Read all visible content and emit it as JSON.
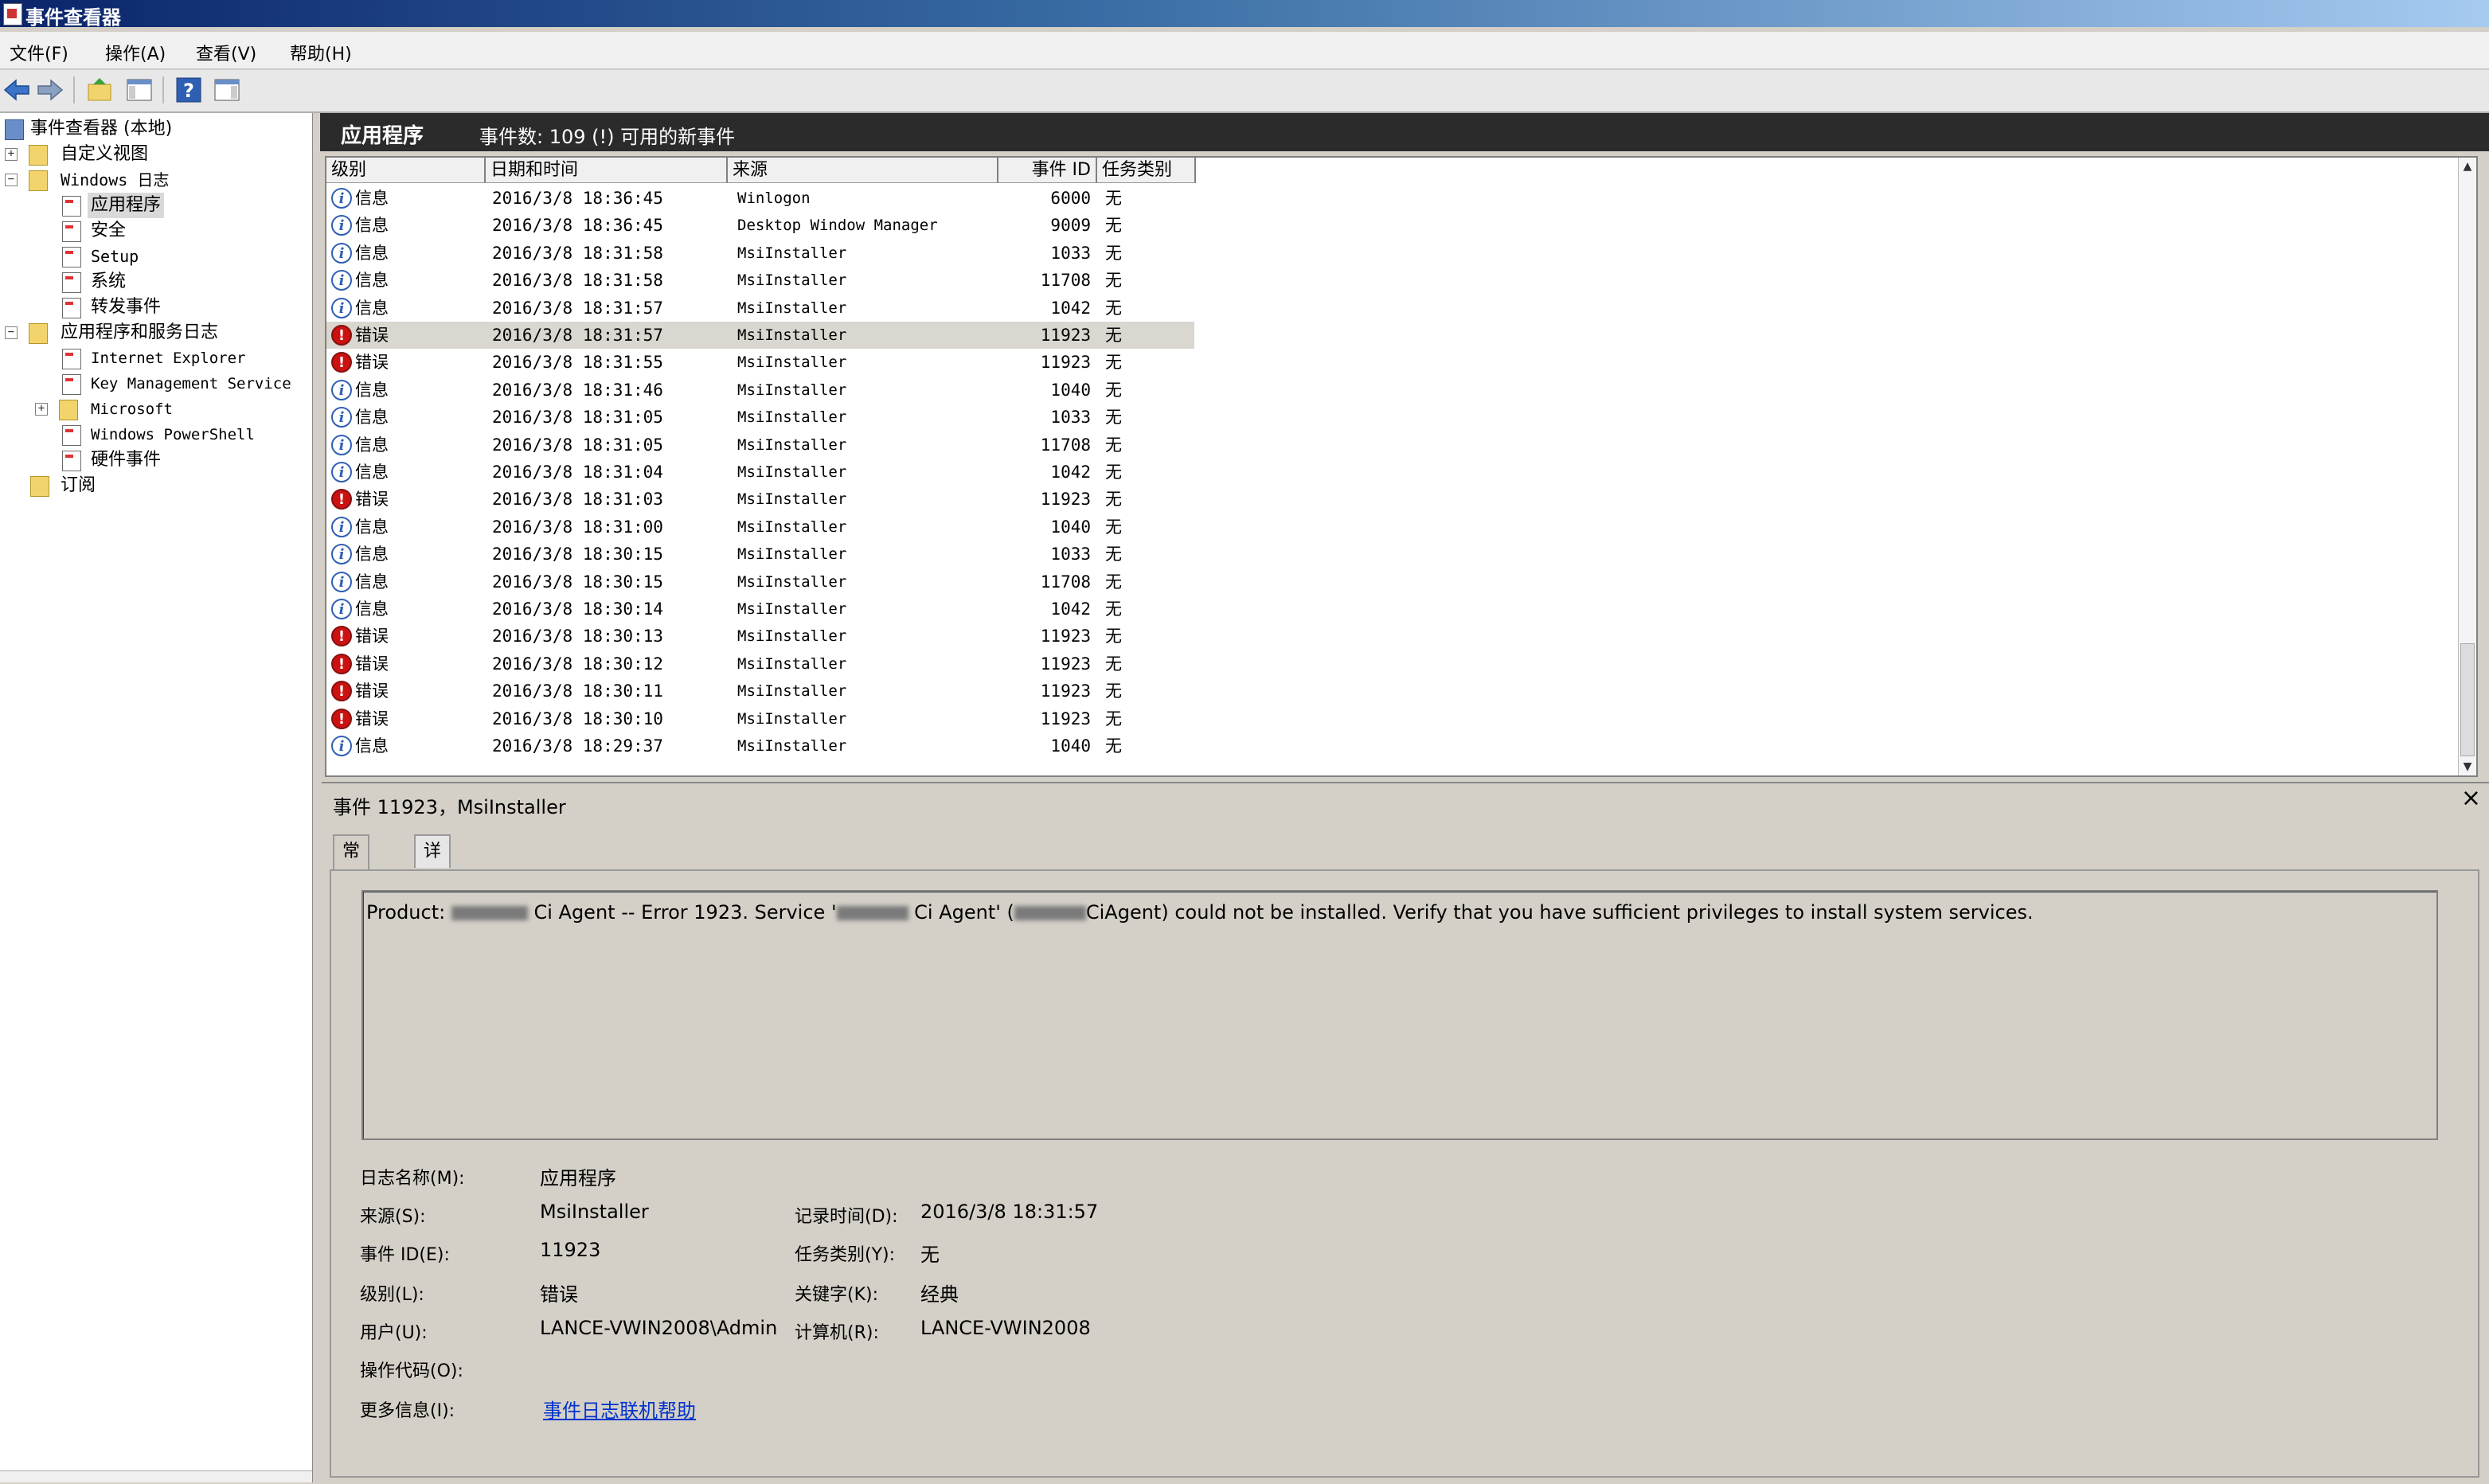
{
  "window": {
    "title": "事件查看器"
  },
  "menu": [
    "文件(F)",
    "操作(A)",
    "查看(V)",
    "帮助(H)"
  ],
  "toolbar": {
    "icons": [
      "back-arrow-icon",
      "forward-arrow-icon",
      "up-folder-icon",
      "console-tree-icon",
      "help-icon",
      "action-pane-icon"
    ],
    "help_glyph": "?"
  },
  "nav_tree": {
    "root": "事件查看器 (本地)",
    "custom_views": "自定义视图",
    "windows_logs": "Windows 日志",
    "application": "应用程序",
    "security": "安全",
    "setup": "Setup",
    "system": "系统",
    "forwarded": "转发事件",
    "app_service_logs": "应用程序和服务日志",
    "ie": "Internet Explorer",
    "kms": "Key Management Service",
    "microsoft": "Microsoft",
    "powershell": "Windows PowerShell",
    "hardware": "硬件事件",
    "subscriptions": "订阅"
  },
  "center_header": {
    "title": "应用程序",
    "summary": "事件数: 109 (!) 可用的新事件"
  },
  "event_list": {
    "columns": [
      "级别",
      "日期和时间",
      "来源",
      "事件 ID",
      "任务类别"
    ],
    "rows": [
      {
        "level": "信息",
        "type": "info",
        "datetime": "2016/3/8 18:36:45",
        "source": "Winlogon",
        "id": "6000",
        "task": "无"
      },
      {
        "level": "信息",
        "type": "info",
        "datetime": "2016/3/8 18:36:45",
        "source": "Desktop Window Manager",
        "id": "9009",
        "task": "无"
      },
      {
        "level": "信息",
        "type": "info",
        "datetime": "2016/3/8 18:31:58",
        "source": "MsiInstaller",
        "id": "1033",
        "task": "无"
      },
      {
        "level": "信息",
        "type": "info",
        "datetime": "2016/3/8 18:31:58",
        "source": "MsiInstaller",
        "id": "11708",
        "task": "无"
      },
      {
        "level": "信息",
        "type": "info",
        "datetime": "2016/3/8 18:31:57",
        "source": "MsiInstaller",
        "id": "1042",
        "task": "无"
      },
      {
        "level": "错误",
        "type": "error",
        "datetime": "2016/3/8 18:31:57",
        "source": "MsiInstaller",
        "id": "11923",
        "task": "无",
        "selected": true
      },
      {
        "level": "错误",
        "type": "error",
        "datetime": "2016/3/8 18:31:55",
        "source": "MsiInstaller",
        "id": "11923",
        "task": "无"
      },
      {
        "level": "信息",
        "type": "info",
        "datetime": "2016/3/8 18:31:46",
        "source": "MsiInstaller",
        "id": "1040",
        "task": "无"
      },
      {
        "level": "信息",
        "type": "info",
        "datetime": "2016/3/8 18:31:05",
        "source": "MsiInstaller",
        "id": "1033",
        "task": "无"
      },
      {
        "level": "信息",
        "type": "info",
        "datetime": "2016/3/8 18:31:05",
        "source": "MsiInstaller",
        "id": "11708",
        "task": "无"
      },
      {
        "level": "信息",
        "type": "info",
        "datetime": "2016/3/8 18:31:04",
        "source": "MsiInstaller",
        "id": "1042",
        "task": "无"
      },
      {
        "level": "错误",
        "type": "error",
        "datetime": "2016/3/8 18:31:03",
        "source": "MsiInstaller",
        "id": "11923",
        "task": "无"
      },
      {
        "level": "信息",
        "type": "info",
        "datetime": "2016/3/8 18:31:00",
        "source": "MsiInstaller",
        "id": "1040",
        "task": "无"
      },
      {
        "level": "信息",
        "type": "info",
        "datetime": "2016/3/8 18:30:15",
        "source": "MsiInstaller",
        "id": "1033",
        "task": "无"
      },
      {
        "level": "信息",
        "type": "info",
        "datetime": "2016/3/8 18:30:15",
        "source": "MsiInstaller",
        "id": "11708",
        "task": "无"
      },
      {
        "level": "信息",
        "type": "info",
        "datetime": "2016/3/8 18:30:14",
        "source": "MsiInstaller",
        "id": "1042",
        "task": "无"
      },
      {
        "level": "错误",
        "type": "error",
        "datetime": "2016/3/8 18:30:13",
        "source": "MsiInstaller",
        "id": "11923",
        "task": "无"
      },
      {
        "level": "错误",
        "type": "error",
        "datetime": "2016/3/8 18:30:12",
        "source": "MsiInstaller",
        "id": "11923",
        "task": "无"
      },
      {
        "level": "错误",
        "type": "error",
        "datetime": "2016/3/8 18:30:11",
        "source": "MsiInstaller",
        "id": "11923",
        "task": "无"
      },
      {
        "level": "错误",
        "type": "error",
        "datetime": "2016/3/8 18:30:10",
        "source": "MsiInstaller",
        "id": "11923",
        "task": "无"
      },
      {
        "level": "信息",
        "type": "info",
        "datetime": "2016/3/8 18:29:37",
        "source": "MsiInstaller",
        "id": "1040",
        "task": "无"
      }
    ]
  },
  "detail": {
    "title": "事件 11923，MsiInstaller",
    "tabs": [
      "常规",
      "详细信息"
    ],
    "message_prefix": "Product: ",
    "message_part1": " Ci Agent -- Error 1923. Service '",
    "message_part2": " Ci Agent' (",
    "message_part3": "CiAgent) could not be installed.  Verify that you have sufficient privileges to install system services.",
    "fields": {
      "log_name_label": "日志名称(M):",
      "log_name": "应用程序",
      "source_label": "来源(S):",
      "source": "MsiInstaller",
      "logged_label": "记录时间(D):",
      "logged": "2016/3/8 18:31:57",
      "event_id_label": "事件 ID(E):",
      "event_id": "11923",
      "task_label": "任务类别(Y):",
      "task": "无",
      "level_label": "级别(L):",
      "level": "错误",
      "keywords_label": "关键字(K):",
      "keywords": "经典",
      "user_label": "用户(U):",
      "user": "LANCE-VWIN2008\\Admin",
      "computer_label": "计算机(R):",
      "computer": "LANCE-VWIN2008",
      "opcode_label": "操作代码(O):",
      "more_info_label": "更多信息(I):",
      "more_info_link": "事件日志联机帮助"
    },
    "close_glyph": "×"
  },
  "colors": {
    "error": "#cc1111",
    "info": "#2f5fb3",
    "link": "#0033cc",
    "titlebar": "#0a246a"
  }
}
